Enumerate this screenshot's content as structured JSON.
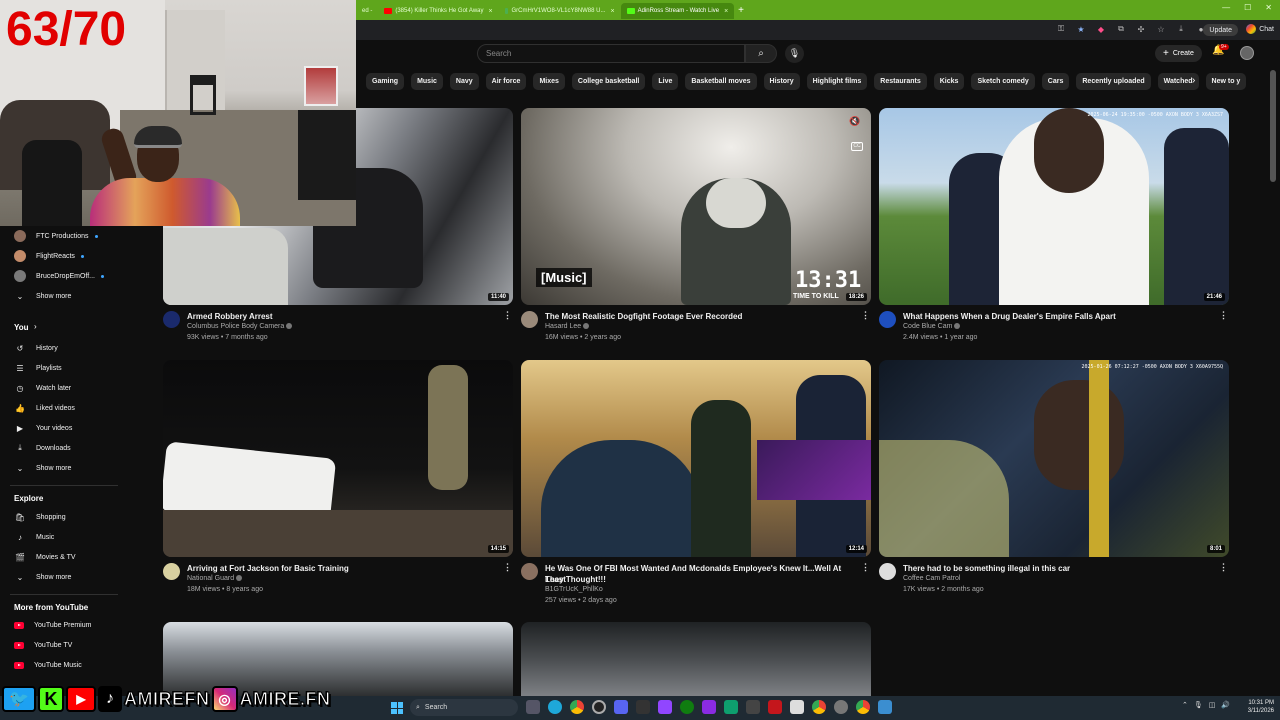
{
  "browser": {
    "tabs": [
      {
        "label": "ed -",
        "color": "#aaaaaa",
        "active": false
      },
      {
        "label": "(3854) Killer Thinks He Got Away",
        "color": "#ff0000",
        "active": false
      },
      {
        "label": "GrCmHrV1WO8-VL1cY8NW88 U...",
        "color": "#4caf50",
        "active": false
      },
      {
        "label": "AdinRoss Stream - Watch Live",
        "color": "#53fc18",
        "active": true
      }
    ],
    "update_label": "Update",
    "chat_label": "Chat"
  },
  "header": {
    "search_placeholder": "Search",
    "create_label": "Create",
    "notification_count": "9+"
  },
  "chips": [
    "Gaming",
    "Music",
    "Navy",
    "Air force",
    "Mixes",
    "College basketball",
    "Live",
    "Basketball moves",
    "History",
    "Highlight films",
    "Restaurants",
    "Kicks",
    "Sketch comedy",
    "Cars",
    "Recently uploaded",
    "Watched",
    "New to y"
  ],
  "sidebar": {
    "subscriptions": [
      {
        "label": "FTC Productions",
        "color": "#8a6a5a"
      },
      {
        "label": "FlightReacts",
        "color": "#c48c6a"
      },
      {
        "label": "BruceDropEmOff...",
        "color": "#7a7a7a"
      }
    ],
    "show_more_1": "Show more",
    "you_heading": "You",
    "you_items": [
      {
        "label": "History",
        "icon": "history-icon",
        "glyph": "↺"
      },
      {
        "label": "Playlists",
        "icon": "playlists-icon",
        "glyph": "☰"
      },
      {
        "label": "Watch later",
        "icon": "watch-later-icon",
        "glyph": "◷"
      },
      {
        "label": "Liked videos",
        "icon": "like-icon",
        "glyph": "👍"
      },
      {
        "label": "Your videos",
        "icon": "your-videos-icon",
        "glyph": "▶"
      },
      {
        "label": "Downloads",
        "icon": "download-icon",
        "glyph": "⤓"
      }
    ],
    "show_more_2": "Show more",
    "explore_heading": "Explore",
    "explore_items": [
      {
        "label": "Shopping",
        "icon": "shopping-icon",
        "glyph": "🛍"
      },
      {
        "label": "Music",
        "icon": "music-icon",
        "glyph": "♪"
      },
      {
        "label": "Movies & TV",
        "icon": "movies-icon",
        "glyph": "🎬"
      }
    ],
    "show_more_3": "Show more",
    "more_heading": "More from YouTube",
    "more_items": [
      {
        "label": "YouTube Premium"
      },
      {
        "label": "YouTube TV"
      },
      {
        "label": "YouTube Music"
      }
    ]
  },
  "videos": [
    {
      "title": "Armed Robbery Arrest",
      "title2": "",
      "channel": "Columbus Police Body Camera",
      "meta": "93K views • 7 months ago",
      "duration": "11:40",
      "avatar_color": "#1a2a6c"
    },
    {
      "title": "The Most Realistic Dogfight Footage Ever Recorded",
      "title2": "",
      "channel": "Hasard Lee",
      "meta": "16M views • 2 years ago",
      "duration": "18:26",
      "avatar_color": "#9a8a7a",
      "caption": "[Music]",
      "overlay_time": "13:31",
      "overlay_label": "TIME TO KILL"
    },
    {
      "title": "What Happens When a Drug Dealer's Empire Falls Apart",
      "title2": "",
      "channel": "Code Blue Cam",
      "meta": "2.4M views • 1 year ago",
      "duration": "21:46",
      "avatar_color": "#1e4fbf"
    },
    {
      "title": "Arriving at Fort Jackson for Basic Training",
      "title2": "",
      "channel": "National Guard",
      "meta": "18M views • 8 years ago",
      "duration": "14:15",
      "avatar_color": "#d8d0a0"
    },
    {
      "title": "He Was One Of FBI Most Wanted And Mcdonalds Employee's Knew It...Well At Least",
      "title2": "They Thought!!!",
      "channel": "B1GTrUcK_PhllKo",
      "meta": "257 views • 2 days ago",
      "duration": "12:14",
      "avatar_color": "#8a7060"
    },
    {
      "title": "There had to be something illegal in this car",
      "title2": "",
      "channel": "Coffee Cam Patrol",
      "meta": "17K views • 2 months ago",
      "duration": "8:01",
      "avatar_color": "#dddddd"
    }
  ],
  "bodycam": {
    "stamp1": "2025-06-24 19:35:00 -0500 AXON BODY 3 X6A3ZS7",
    "stamp2": "2025-01-26 07:12:27 -0500 AXON BODY 3 X60A9755Q"
  },
  "overlay": {
    "counter": "63/70",
    "handle1": "AMIREFN",
    "handle2": "AMIRE.FN"
  },
  "taskbar": {
    "search_label": "Search",
    "time": "10:31 PM",
    "date": "3/11/2026"
  },
  "colors": {
    "accent_red": "#ff0033",
    "brand_green": "#5fa61c",
    "counter_red": "#e10000"
  }
}
